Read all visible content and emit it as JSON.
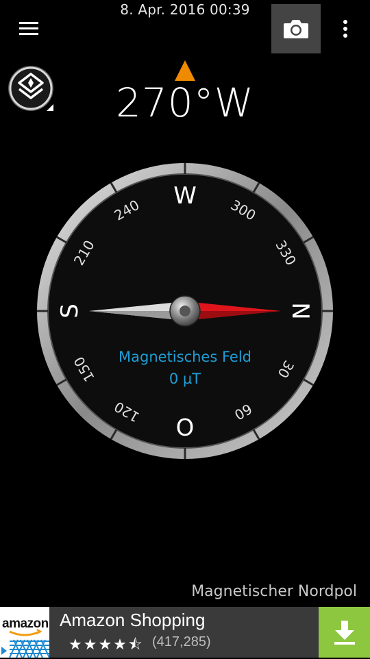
{
  "status": {
    "datetime": "8. Apr. 2016 00:39"
  },
  "toolbar": {
    "menu_icon": "menu-icon",
    "camera_icon": "camera-icon",
    "overflow_icon": "more-vert-icon"
  },
  "layers": {
    "icon": "layers-icon"
  },
  "heading": {
    "text": "270°W",
    "pointer_color": "#f08a00"
  },
  "compass": {
    "cardinals": {
      "north": "N",
      "east": "O",
      "south": "S",
      "west": "W"
    },
    "degree_labels": [
      "30",
      "60",
      "120",
      "150",
      "210",
      "240",
      "300",
      "330"
    ],
    "needle_north_color": "#e0151c",
    "needle_south_color": "#dcdcdc"
  },
  "field": {
    "label": "Magnetisches Feld",
    "value": "0 µT",
    "color": "#1e9fd6"
  },
  "pole": {
    "label": "Magnetischer Nordpol"
  },
  "ad": {
    "logo_text": "amazon",
    "title": "Amazon Shopping",
    "stars": "★★★★⯪",
    "rating_count": "(417,285)",
    "download_icon": "download-icon",
    "button_color": "#8dc63f"
  }
}
